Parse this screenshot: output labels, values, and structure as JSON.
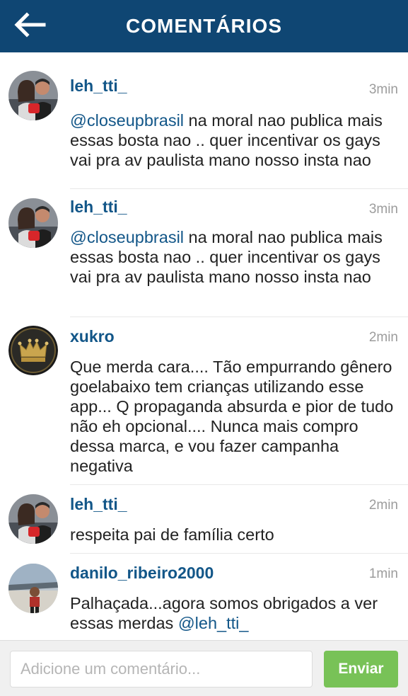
{
  "header": {
    "title": "COMENTÁRIOS",
    "back_icon": "back-arrow-icon"
  },
  "comments": [
    {
      "username": "leh_tti_",
      "time": "3min",
      "mention": "@closeupbrasil",
      "text": "  na moral nao publica mais essas bosta nao .. quer incentivar os gays vai pra av paulista mano nosso insta nao"
    },
    {
      "username": "leh_tti_",
      "time": "3min",
      "mention": "@closeupbrasil",
      "text": "  na moral nao publica mais essas bosta nao .. quer incentivar os gays vai pra av paulista mano nosso insta nao"
    },
    {
      "username": "xukro",
      "time": "2min",
      "text": "Que merda cara.... Tão empurrando gênero goelabaixo tem crianças utilizando esse app... Q propaganda absurda e pior de tudo não eh opcional.... Nunca mais compro dessa marca, e vou fazer campanha negativa"
    },
    {
      "username": "leh_tti_",
      "time": "2min",
      "text": "respeita pai de família certo"
    },
    {
      "username": "danilo_ribeiro2000",
      "time": "1min",
      "text": "Palhaçada...agora somos obrigados a ver essas merdas ",
      "mention_end": "@leh_tti_"
    }
  ],
  "composer": {
    "placeholder": "Adicione um comentário...",
    "value": "",
    "send_label": "Enviar"
  },
  "colors": {
    "header_bg": "#0f4673",
    "username": "#125688",
    "send_button": "#78c257"
  }
}
